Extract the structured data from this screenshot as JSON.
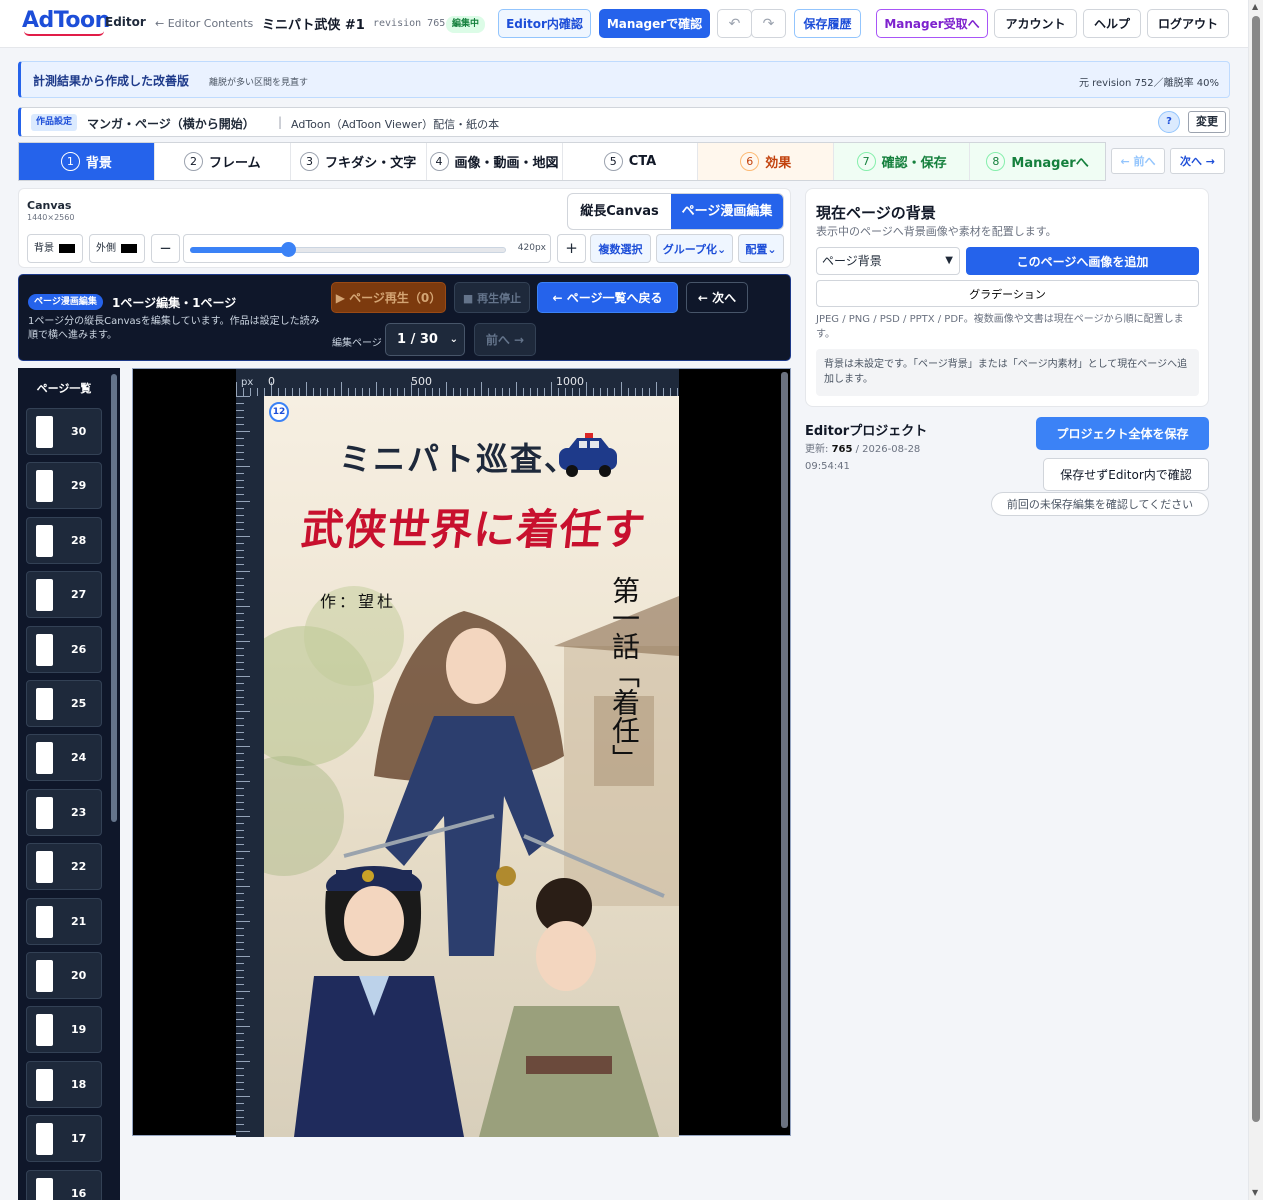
{
  "header": {
    "logo": "AdToon",
    "logo_sub": "Editor",
    "back_link": "← Editor Contents",
    "project_title": "ミニパト武侠 #1",
    "revision": "revision 765",
    "status_badge": "編集中",
    "btn_preview": "Editor内確認",
    "btn_manager_check": "Managerで確認",
    "undo": "↶",
    "redo": "↷",
    "btn_history": "保存履歴",
    "btn_manager_inbox": "Manager受取へ",
    "btn_account": "アカウント",
    "btn_help": "ヘルプ",
    "btn_logout": "ログアウト"
  },
  "banner": {
    "title": "計測結果から作成した改善版",
    "subtitle": "離脱が多い区間を見直す",
    "meta": "元 revision 752／離脱率 40%"
  },
  "settings": {
    "tag": "作品設定",
    "format": "マンガ・ページ（横から開始）",
    "separator": "|",
    "delivery": "AdToon（AdToon Viewer）配信・紙の本",
    "help": "?",
    "change": "変更"
  },
  "steps": [
    {
      "num": "1",
      "label": "背景"
    },
    {
      "num": "2",
      "label": "フレーム"
    },
    {
      "num": "3",
      "label": "フキダシ・文字"
    },
    {
      "num": "4",
      "label": "画像・動画・地図"
    },
    {
      "num": "5",
      "label": "CTA"
    },
    {
      "num": "6",
      "label": "効果"
    },
    {
      "num": "7",
      "label": "確認・保存"
    },
    {
      "num": "8",
      "label": "Managerへ"
    }
  ],
  "step_nav": {
    "prev": "← 前へ",
    "next": "次へ →"
  },
  "canvas_panel": {
    "name": "Canvas",
    "size": "1440×2560",
    "mode_vertical": "縦長Canvas",
    "mode_page": "ページ漫画編集",
    "bg_label": "背景",
    "outside_label": "外側",
    "zoom_out": "−",
    "zoom_in": "+",
    "zoom_value": "420px",
    "zoom_fraction": 0.31,
    "multi_select": "複数選択",
    "group": "グループ化⌄",
    "arrange": "配置⌄"
  },
  "page_bar": {
    "pill": "ページ漫画編集",
    "title": "1ページ編集・1ページ",
    "desc": "1ページ分の縦長Canvasを編集しています。作品は設定した読み順で横へ進みます。",
    "play": "▶ ページ再生（0）",
    "stop": "■ 再生停止",
    "back_to_list": "← ページ一覧へ戻る",
    "next": "← 次へ",
    "edit_page_label": "編集ページ",
    "page_select": "1 / 30",
    "prev": "前へ →"
  },
  "page_list": {
    "header": "ページ一覧",
    "pages": [
      "30",
      "29",
      "28",
      "27",
      "26",
      "25",
      "24",
      "23",
      "22",
      "21",
      "20",
      "19",
      "18",
      "17",
      "16"
    ]
  },
  "canvas": {
    "ruler_unit": "px",
    "ruler_labels": [
      "0",
      "500",
      "1000"
    ],
    "page_badge": "12",
    "art_title_1": "ミニパト巡査、",
    "art_title_2": "武侠世界に着任す",
    "art_author": "作：望杜",
    "art_vertical": "第一話「着任」"
  },
  "right_panel": {
    "title": "現在ページの背景",
    "subtitle": "表示中のページへ背景画像や素材を配置します。",
    "select_value": "ページ背景",
    "add_image": "このページへ画像を追加",
    "gradient": "グラデーション",
    "formats": "JPEG / PNG / PSD / PPTX / PDF。複数画像や文書は現在ページから順に配置します。",
    "note": "背景は未設定です。「ページ背景」または「ページ内素材」として現在ページへ追加します。"
  },
  "project": {
    "title": "Editorプロジェクト",
    "updated_label": "更新:",
    "updated_rev": "765",
    "updated_date": "/ 2026-08-28",
    "updated_time": "09:54:41",
    "save_all": "プロジェクト全体を保存",
    "check_without_save": "保存せずEditor内で確認",
    "check_unsaved": "前回の未保存編集を確認してください"
  },
  "colors": {
    "accent": "#2563eb",
    "danger_title": "#c8102e",
    "dark_panel": "#0f172a"
  }
}
